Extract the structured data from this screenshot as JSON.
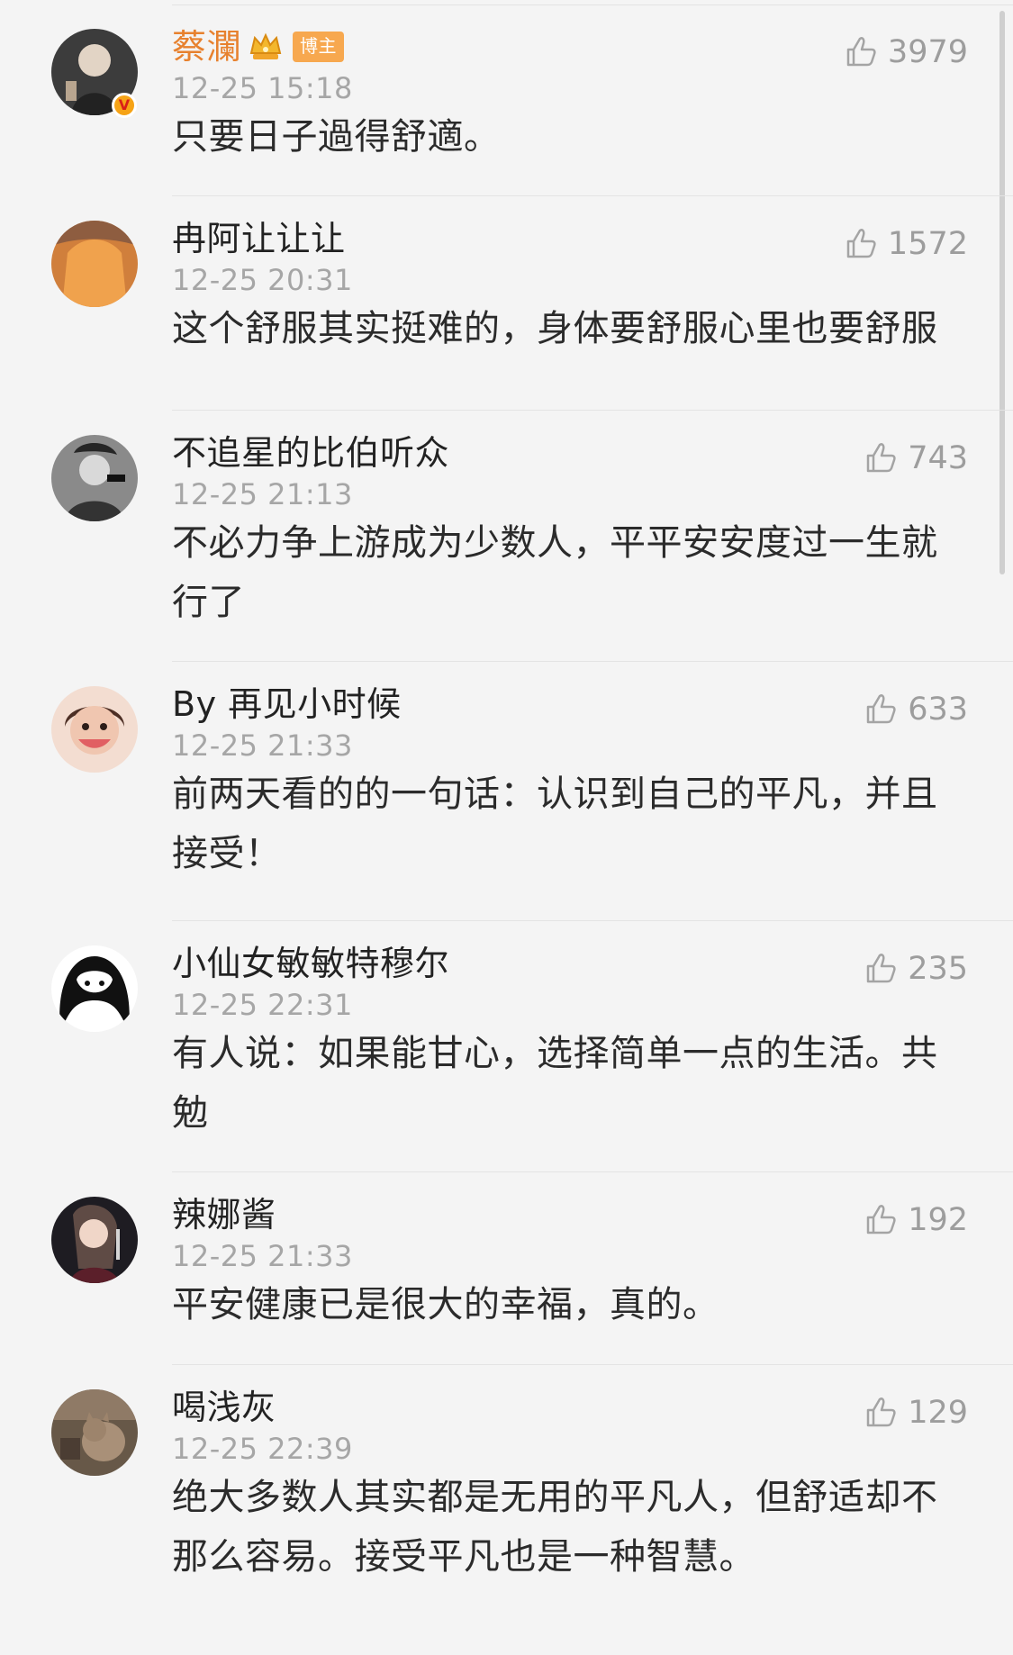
{
  "comments": [
    {
      "name": "蔡瀾",
      "name_color": "#e7812e",
      "crown_icon": "crown-icon",
      "tag": "博主",
      "verified": true,
      "verified_symbol": "V",
      "time": "12-25 15:18",
      "likes": "3979",
      "text": "只要日子過得舒適。",
      "avatar_colors": {
        "bg": "#4b4b4b",
        "fg": "#d9d0c2"
      }
    },
    {
      "name": "冉阿让让让",
      "time": "12-25 20:31",
      "likes": "1572",
      "text": "这个舒服其实挺难的，身体要舒服心里也要舒服",
      "avatar_colors": {
        "bg": "#c77a3a",
        "fg": "#f1a54f"
      }
    },
    {
      "name": "不追星的比伯听众",
      "time": "12-25 21:13",
      "likes": "743",
      "text": "不必力争上游成为少数人，平平安安度过一生就行了",
      "avatar_colors": {
        "bg": "#7a7a7a",
        "fg": "#e8e8e8"
      }
    },
    {
      "name": "By 再见小时候",
      "time": "12-25 21:33",
      "likes": "633",
      "text": "前两天看的的一句话：认识到自己的平凡，并且接受！",
      "avatar_colors": {
        "bg": "#f0d2c3",
        "fg": "#5a3a2c"
      }
    },
    {
      "name": "小仙女敏敏特穆尔",
      "time": "12-25 22:31",
      "likes": "235",
      "text": "有人说：如果能甘心，选择简单一点的生活。共勉",
      "avatar_colors": {
        "bg": "#ffffff",
        "fg": "#111111"
      }
    },
    {
      "name": "辣娜酱",
      "time": "12-25 21:33",
      "likes": "192",
      "text": "平安健康已是很大的幸福，真的。",
      "avatar_colors": {
        "bg": "#2b2430",
        "fg": "#f2d6c8"
      }
    },
    {
      "name": "喝浅灰",
      "time": "12-25 22:39",
      "likes": "129",
      "text": "绝大多数人其实都是无用的平凡人，但舒适却不那么容易。接受平凡也是一种智慧。",
      "avatar_colors": {
        "bg": "#6b5a49",
        "fg": "#b99d7e"
      }
    }
  ],
  "icons": {
    "like": "thumbs-up-icon",
    "crown": "crown-icon",
    "verified": "verified-badge"
  }
}
